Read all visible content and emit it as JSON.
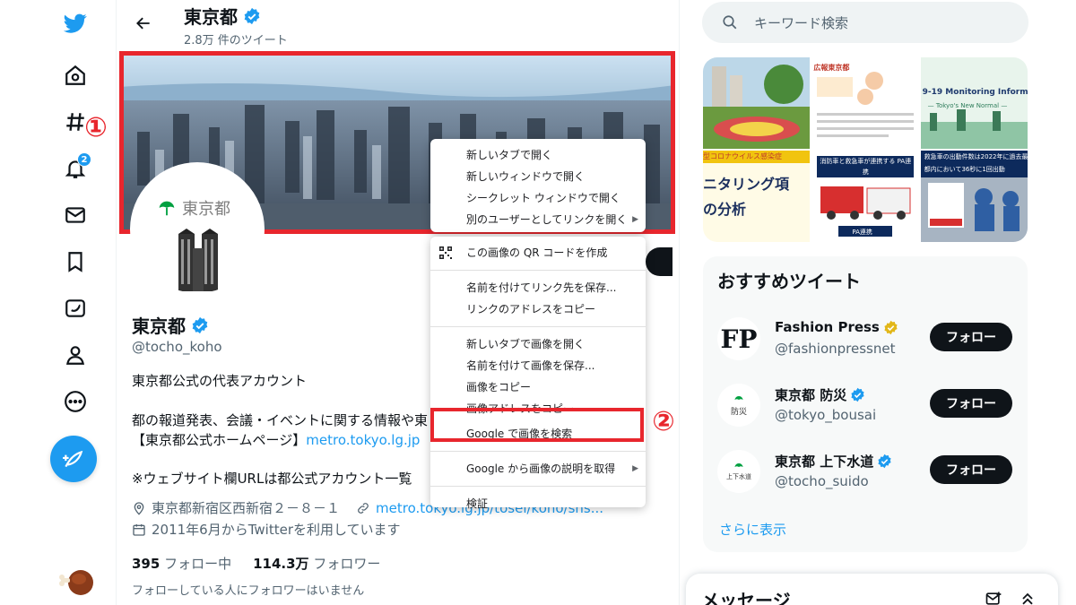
{
  "nav": {
    "notification_count": "2",
    "icons": [
      "twitter-logo-icon",
      "home-icon",
      "explore-icon",
      "notifications-icon",
      "messages-icon",
      "bookmarks-icon",
      "lists-icon",
      "profile-icon",
      "more-icon",
      "compose-tweet-icon"
    ]
  },
  "header": {
    "name": "東京都",
    "tweet_count": "2.8万 件のツイート"
  },
  "profile": {
    "avatar_logo_text": "東京都",
    "name": "東京都",
    "handle": "@tocho_koho",
    "bio_line1": "東京都公式の代表アカウント",
    "bio_line2": "都の報道発表、会議・イベントに関する情報や東",
    "bio_line3_prefix": "【東京都公式ホームページ】",
    "bio_line3_link": "metro.tokyo.lg.jp",
    "bio_line4": "※ウェブサイト欄URLは都公式アカウント一覧",
    "location": "東京都新宿区西新宿２－８－１",
    "website": "metro.tokyo.lg.jp/tosei/koho/sns...",
    "joined": "2011年6月からTwitterを利用しています",
    "following_count": "395",
    "following_label": "フォロー中",
    "followers_count": "114.3万",
    "followers_label": "フォロワー",
    "followers_note": "フォローしている人にフォロワーはいません"
  },
  "annotations": {
    "marker1": "①",
    "marker2": "②",
    "highlight_color": "#e8262d"
  },
  "context_menu_link": [
    {
      "label": "新しいタブで開く",
      "submenu": false
    },
    {
      "label": "新しいウィンドウで開く",
      "submenu": false
    },
    {
      "label": "シークレット ウィンドウで開く",
      "submenu": false
    },
    {
      "label": "別のユーザーとしてリンクを開く",
      "submenu": true
    }
  ],
  "context_menu_image": {
    "qr": "この画像の QR コードを作成",
    "save_link": "名前を付けてリンク先を保存...",
    "copy_link": "リンクのアドレスをコピー",
    "open_image": "新しいタブで画像を開く",
    "save_image": "名前を付けて画像を保存...",
    "copy_image": "画像をコピー",
    "copy_image_address": "画像アドレスをコピー",
    "search_google": "Google で画像を検索",
    "image_description": "Google から画像の説明を取得",
    "inspect": "検証",
    "submenu_arrow": "▶"
  },
  "search": {
    "placeholder": "キーワード検索"
  },
  "media": [
    {
      "text": ""
    },
    {
      "text": "広報東京都"
    },
    {
      "text": "9-19 Monitoring Informa"
    },
    {
      "text": "型コロナウイルス感染症"
    },
    {
      "text": "消防車と救急車が連携する PA連携"
    },
    {
      "text": "救急車の出動件数は2022年に過去最多"
    }
  ],
  "media_subtext": {
    "cell3": "— Tokyo's New Normal —",
    "cell4a": "ニタリング項",
    "cell4b": "の分析",
    "cell5": "PA連携",
    "cell6": "都内において36秒に1回出動"
  },
  "recommended": {
    "title": "おすすめツイート",
    "items": [
      {
        "name": "Fashion Press",
        "handle": "@fashionpressnet",
        "avatar_text": "FP",
        "verified": "gold",
        "follow": "フォロー"
      },
      {
        "name": "東京都 防災",
        "handle": "@tokyo_bousai",
        "avatar_text": "防災",
        "verified": "blue",
        "follow": "フォロー"
      },
      {
        "name": "東京都 上下水道",
        "handle": "@tocho_suido",
        "avatar_text": "上下水道",
        "verified": "blue",
        "follow": "フォロー"
      }
    ],
    "more": "さらに表示"
  },
  "messages": {
    "title": "メッセージ"
  },
  "colors": {
    "accent": "#1d9bf0",
    "verified_gold": "#e2b719",
    "text": "#0f1419"
  }
}
